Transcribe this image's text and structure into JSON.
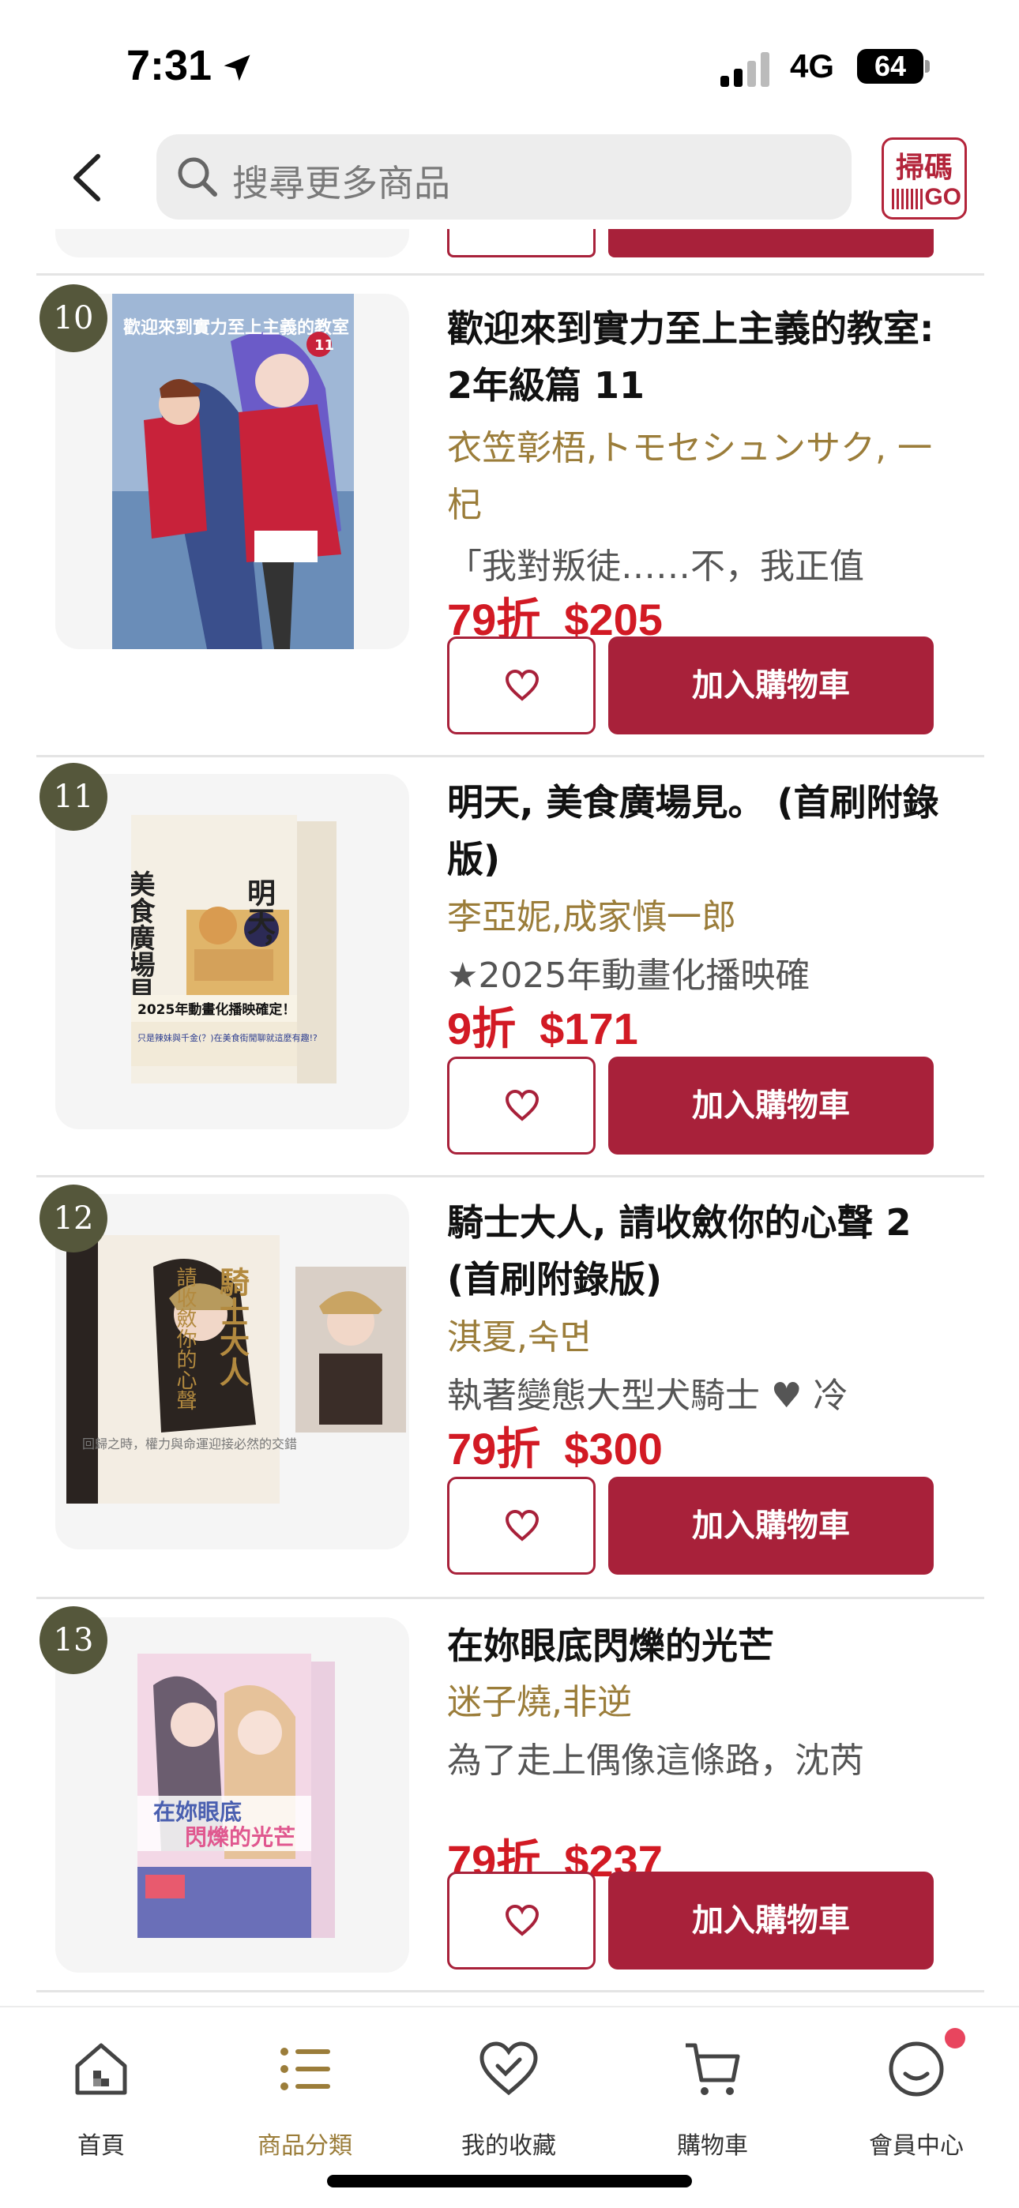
{
  "status_bar": {
    "time": "7:31",
    "network": "4G",
    "battery": "64"
  },
  "search": {
    "placeholder": "搜尋更多商品"
  },
  "scan": {
    "top": "掃碼",
    "bottom": "GO"
  },
  "items": [
    {
      "rank": "10",
      "title": "歡迎來到實力至上主義的教室: 2年級篇 11",
      "author": "衣笠彰梧,トモセシュンサク, 一杞",
      "desc": "「我對叛徒……不，我正值",
      "discount": "79折",
      "price": "$205",
      "cart_label": "加入購物車",
      "cover_text": "歡迎來到實力至上主義的教室",
      "cover_volume": "11"
    },
    {
      "rank": "11",
      "title": "明天, 美食廣場見。 (首刷附錄版)",
      "author": "李亞妮,成家慎一郎",
      "desc": "★2025年動畫化播映確",
      "discount": "9折",
      "price": "$171",
      "cart_label": "加入購物車",
      "cover_text_a": "明天，",
      "cover_text_b": "美食廣場見",
      "cover_band": "2025年動畫化播映確定！",
      "cover_band2": "只是辣妹與千金(？)在美食街閒聊就這麼有趣!?"
    },
    {
      "rank": "12",
      "title": "騎士大人, 請收斂你的心聲 2 (首刷附錄版)",
      "author": "淇夏,숙면",
      "desc": "執著變態大型犬騎士 ♥ 冷",
      "discount": "79折",
      "price": "$300",
      "cart_label": "加入購物車",
      "cover_text_a": "騎士大人",
      "cover_text_b": "請收斂你的心聲",
      "cover_band": "回歸之時，權力與命運迎接必然的交錯"
    },
    {
      "rank": "13",
      "title": "在妳眼底閃爍的光芒",
      "author": "迷子燒,非逆",
      "desc": "為了走上偶像這條路，沈芮",
      "discount": "79折",
      "price": "$237",
      "cart_label": "加入購物車",
      "cover_text_a": "在妳眼底",
      "cover_text_b": "閃爍的光芒"
    }
  ],
  "tabbar": [
    {
      "label": "首頁",
      "icon": "home-icon"
    },
    {
      "label": "商品分類",
      "icon": "category-list-icon"
    },
    {
      "label": "我的收藏",
      "icon": "heart-check-icon"
    },
    {
      "label": "購物車",
      "icon": "cart-icon"
    },
    {
      "label": "會員中心",
      "icon": "member-smile-icon"
    }
  ],
  "colors": {
    "brand": "#a8213a",
    "price": "#d21a24",
    "author": "#9b7d3a",
    "rank_badge": "#55573b",
    "active_tab": "#9b7d3a"
  }
}
